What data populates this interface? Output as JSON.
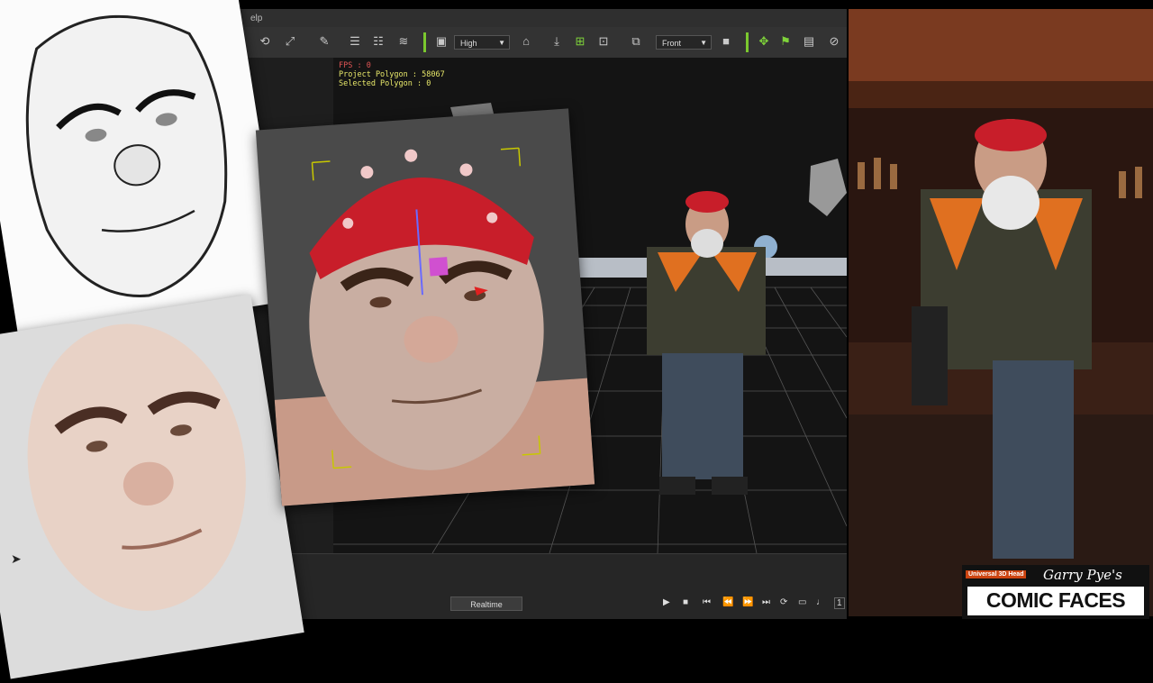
{
  "menubar": {
    "label": "elp"
  },
  "toolbar": {
    "quality_value": "High",
    "view_value": "Front"
  },
  "stats": {
    "fps": "FPS : 0",
    "project_polygon": "Project Polygon : 58067",
    "selected_polygon": "Selected Polygon : 0"
  },
  "timeline": {
    "realtime_label": "Realtime",
    "frame_value": "1"
  },
  "logo": {
    "subtitle": "Universal 3D Head",
    "signature": "Garry Pye's",
    "title": "COMIC FACES"
  },
  "colors": {
    "accent_green": "#7bc82e",
    "fps_red": "#e25555",
    "stats_yellow": "#e8e86a",
    "bandana_red": "#c81e2a"
  },
  "icons": [
    "rotate-icon",
    "clean-icon",
    "align-icon",
    "grid-icon",
    "home-icon",
    "download-icon",
    "add-icon",
    "camera-icon",
    "flag-icon",
    "video-icon"
  ]
}
